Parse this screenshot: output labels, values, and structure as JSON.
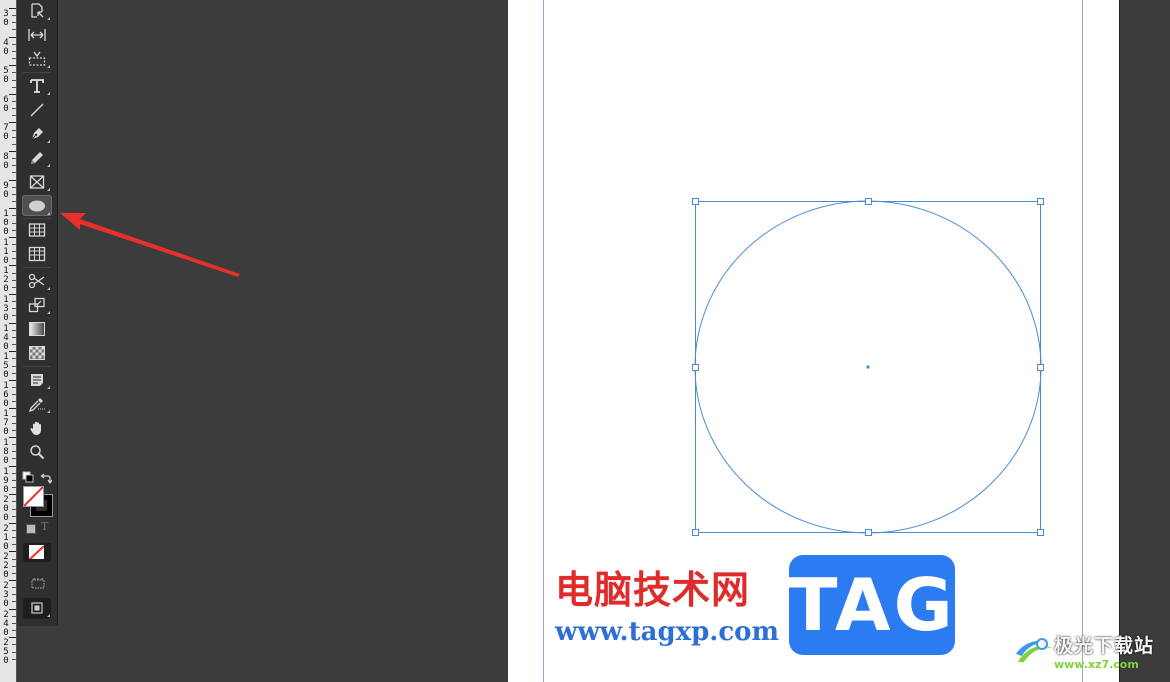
{
  "ruler": {
    "labels": [
      "3\n0",
      "4\n0",
      "5\n0",
      "6\n0",
      "7\n0",
      "8\n0",
      "9\n0",
      "1\n0\n0",
      "1\n1\n0",
      "1\n2\n0",
      "1\n3\n0",
      "1\n4\n0",
      "1\n5\n0",
      "1\n6\n0",
      "1\n7\n0",
      "1\n8\n0",
      "1\n9\n0",
      "2\n0\n0",
      "2\n1\n0",
      "2\n2\n0",
      "2\n3\n0",
      "2\n4\n0",
      "2\n5\n0"
    ]
  },
  "toolbar": {
    "tools": [
      {
        "name": "page-tool",
        "icon": "page-icon"
      },
      {
        "name": "gap-tool",
        "icon": "gap-icon"
      },
      {
        "name": "content-collector-tool",
        "icon": "content-collector-icon"
      },
      {
        "name": "type-tool",
        "icon": "type-icon"
      },
      {
        "name": "line-tool",
        "icon": "line-icon"
      },
      {
        "name": "pen-tool",
        "icon": "pen-icon"
      },
      {
        "name": "pencil-tool",
        "icon": "pencil-icon"
      },
      {
        "name": "rectangle-frame-tool",
        "icon": "rectangle-frame-icon"
      },
      {
        "name": "ellipse-tool",
        "icon": "ellipse-icon",
        "active": true
      },
      {
        "name": "table-tool",
        "icon": "table-icon"
      },
      {
        "name": "table-columns-tool",
        "icon": "table-columns-icon"
      },
      {
        "name": "scissors-tool",
        "icon": "scissors-icon"
      },
      {
        "name": "free-transform-tool",
        "icon": "free-transform-icon"
      },
      {
        "name": "gradient-swatch-tool",
        "icon": "gradient-icon"
      },
      {
        "name": "gradient-feather-tool",
        "icon": "gradient-feather-icon"
      },
      {
        "name": "note-tool",
        "icon": "note-icon"
      },
      {
        "name": "eyedropper-tool",
        "icon": "eyedropper-icon"
      },
      {
        "name": "hand-tool",
        "icon": "hand-icon"
      },
      {
        "name": "zoom-tool",
        "icon": "zoom-icon"
      }
    ],
    "formatting_text_label": "T"
  },
  "colors": {
    "pasteboard": "#3c3c3c",
    "toolbar": "#2f2f2f",
    "selection": "#4a8bd6",
    "arrow": "#e8302a",
    "watermark_red": "#e02b2b",
    "watermark_blue": "#2b7cf0"
  },
  "watermark": {
    "cn_title": "电脑技术网",
    "url": "www.tagxp.com",
    "tag": "TAG"
  },
  "corner_logo": {
    "name": "极光下载站",
    "url": "www.xz7.com"
  }
}
